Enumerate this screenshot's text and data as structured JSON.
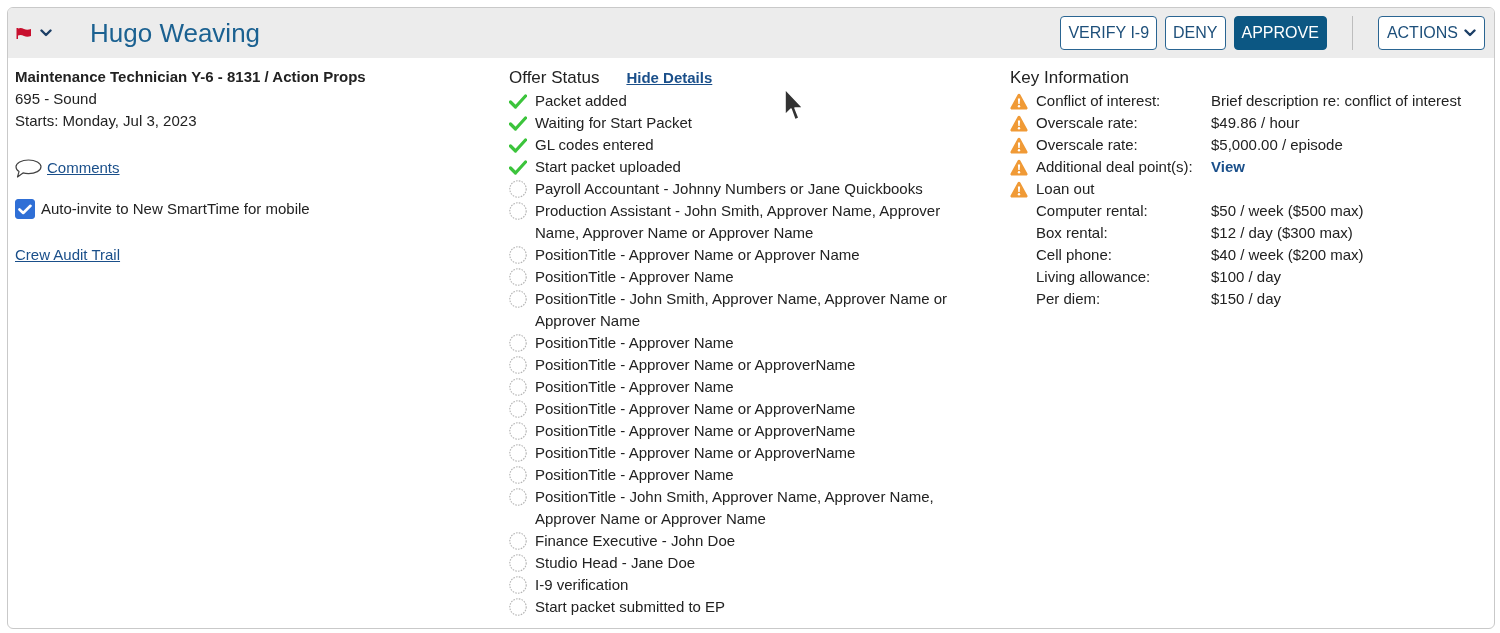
{
  "header": {
    "title": "Hugo Weaving",
    "buttons": [
      {
        "label": "VERIFY I-9",
        "kind": "outline"
      },
      {
        "label": "DENY",
        "kind": "outline"
      },
      {
        "label": "APPROVE",
        "kind": "primary"
      }
    ],
    "menu_button": {
      "label": "ACTIONS"
    }
  },
  "offer": {
    "position": "Maintenance Technician Y-6 - 8131 / Action Props",
    "department": "695 - Sound",
    "start": "Starts: Monday, Jul 3, 2023",
    "comments_link": "Comments",
    "auto_invite": {
      "label": "Auto-invite to New SmartTime for mobile",
      "checked": true
    },
    "audit_link": "Crew Audit Trail"
  },
  "offer_status": {
    "title": "Offer Status",
    "toggle_link": "Hide Details",
    "steps": [
      {
        "label": "Packet added",
        "completed": true
      },
      {
        "label": "Waiting for Start Packet",
        "completed": true
      },
      {
        "label": "GL codes entered",
        "completed": true
      },
      {
        "label": "Start packet uploaded",
        "completed": true
      },
      {
        "label": "Payroll Accountant - Johnny Numbers or Jane Quickbooks",
        "completed": false
      },
      {
        "label": "Production Assistant - John Smith, Approver Name, Approver Name, Approver Name or Approver Name",
        "completed": false
      },
      {
        "label": "PositionTitle - Approver Name or Approver Name",
        "completed": false
      },
      {
        "label": "PositionTitle - Approver Name",
        "completed": false
      },
      {
        "label": "PositionTitle - John Smith, Approver Name, Approver Name or Approver Name",
        "completed": false
      },
      {
        "label": "PositionTitle - Approver Name",
        "completed": false
      },
      {
        "label": "PositionTitle - Approver Name or ApproverName",
        "completed": false
      },
      {
        "label": "PositionTitle - Approver Name",
        "completed": false
      },
      {
        "label": "PositionTitle - Approver Name or ApproverName",
        "completed": false
      },
      {
        "label": "PositionTitle - Approver Name or ApproverName",
        "completed": false
      },
      {
        "label": "PositionTitle - Approver Name or ApproverName",
        "completed": false
      },
      {
        "label": "PositionTitle - Approver Name",
        "completed": false
      },
      {
        "label": "PositionTitle - John Smith, Approver Name, Approver Name, Approver Name or Approver Name",
        "completed": false
      },
      {
        "label": "Finance Executive - John Doe",
        "completed": false
      },
      {
        "label": "Studio Head - Jane Doe",
        "completed": false
      },
      {
        "label": "I-9 verification",
        "completed": false
      },
      {
        "label": "Start packet submitted to EP",
        "completed": false
      }
    ]
  },
  "key_information": {
    "title": "Key Information",
    "items": [
      {
        "label": "Conflict of interest:",
        "value": "Brief description re: conflict of interest",
        "warning": true
      },
      {
        "label": "Overscale rate:",
        "value": "$49.86 / hour",
        "warning": true
      },
      {
        "label": "Overscale rate:",
        "value": "$5,000.00 / episode",
        "warning": true
      },
      {
        "label": "Additional deal point(s):",
        "link": "View",
        "warning": true
      },
      {
        "label": "Loan out",
        "warning": true
      },
      {
        "label": "Computer rental:",
        "value": "$50 / week ($500 max)",
        "warning": false
      },
      {
        "label": "Box rental:",
        "value": "$12 / day ($300 max)",
        "warning": false
      },
      {
        "label": "Cell phone:",
        "value": "$40 / week ($200 max)",
        "warning": false
      },
      {
        "label": "Living allowance:",
        "value": "$100 / day",
        "warning": false
      },
      {
        "label": "Per diem:",
        "value": "$150 / day",
        "warning": false
      }
    ]
  }
}
